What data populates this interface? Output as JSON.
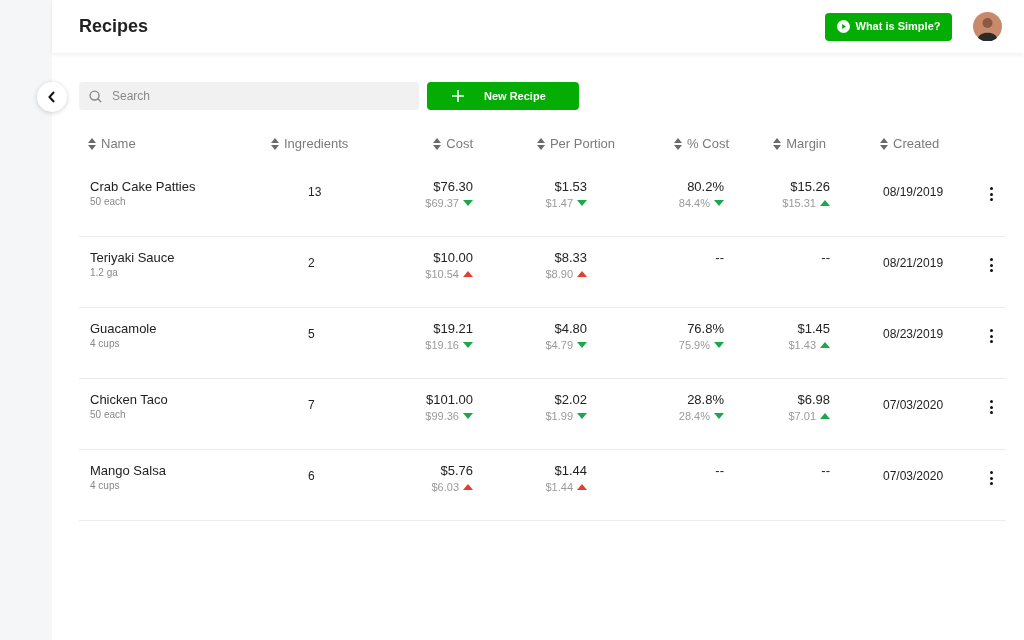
{
  "header": {
    "title": "Recipes",
    "help_button": "What is Simple?"
  },
  "search": {
    "placeholder": "Search"
  },
  "new_button": "New Recipe",
  "columns": [
    "Name",
    "Ingredients",
    "Cost",
    "Per Portion",
    "% Cost",
    "Margin",
    "Created"
  ],
  "rows": [
    {
      "name": "Crab Cake Patties",
      "yield": "50 each",
      "ingredients": "13",
      "cost": {
        "value": "$76.30",
        "previous": "$69.37",
        "rising": false,
        "favorable": true
      },
      "per_portion": {
        "value": "$1.53",
        "previous": "$1.47",
        "rising": false,
        "favorable": true
      },
      "pct_cost": {
        "value": "80.2%",
        "previous": "84.4%",
        "rising": false,
        "favorable": true
      },
      "margin": {
        "value": "$15.26",
        "previous": "$15.31",
        "rising": true,
        "favorable": true
      },
      "created": "08/19/2019"
    },
    {
      "name": "Teriyaki Sauce",
      "yield": "1.2 ga",
      "ingredients": "2",
      "cost": {
        "value": "$10.00",
        "previous": "$10.54",
        "rising": true,
        "favorable": false
      },
      "per_portion": {
        "value": "$8.33",
        "previous": "$8.90",
        "rising": true,
        "favorable": false
      },
      "pct_cost": {
        "value": "--"
      },
      "margin": {
        "value": "--"
      },
      "created": "08/21/2019"
    },
    {
      "name": "Guacamole",
      "yield": "4 cups",
      "ingredients": "5",
      "cost": {
        "value": "$19.21",
        "previous": "$19.16",
        "rising": false,
        "favorable": true
      },
      "per_portion": {
        "value": "$4.80",
        "previous": "$4.79",
        "rising": false,
        "favorable": true
      },
      "pct_cost": {
        "value": "76.8%",
        "previous": "75.9%",
        "rising": false,
        "favorable": true
      },
      "margin": {
        "value": "$1.45",
        "previous": "$1.43",
        "rising": true,
        "favorable": true
      },
      "created": "08/23/2019"
    },
    {
      "name": "Chicken Taco",
      "yield": "50 each",
      "ingredients": "7",
      "cost": {
        "value": "$101.00",
        "previous": "$99.36",
        "rising": false,
        "favorable": true
      },
      "per_portion": {
        "value": "$2.02",
        "previous": "$1.99",
        "rising": false,
        "favorable": true
      },
      "pct_cost": {
        "value": "28.8%",
        "previous": "28.4%",
        "rising": false,
        "favorable": true
      },
      "margin": {
        "value": "$6.98",
        "previous": "$7.01",
        "rising": true,
        "favorable": true
      },
      "created": "07/03/2020"
    },
    {
      "name": "Mango Salsa",
      "yield": "4 cups",
      "ingredients": "6",
      "cost": {
        "value": "$5.76",
        "previous": "$6.03",
        "rising": true,
        "favorable": false
      },
      "per_portion": {
        "value": "$1.44",
        "previous": "$1.44",
        "rising": true,
        "favorable": false
      },
      "pct_cost": {
        "value": "--"
      },
      "margin": {
        "value": "--"
      },
      "created": "07/03/2020"
    }
  ]
}
